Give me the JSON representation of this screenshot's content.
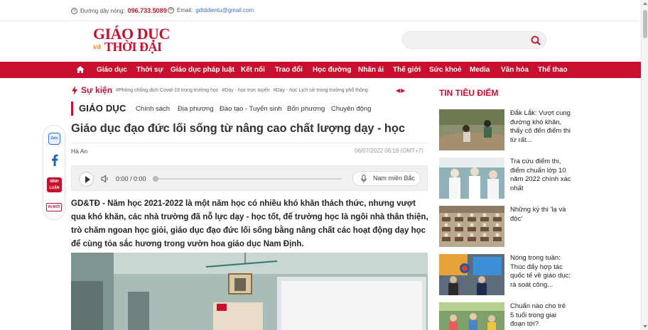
{
  "topbar": {
    "hotline_label": "Đường dây nóng:",
    "hotline_number": "096.733.5089",
    "email_label": "Email:",
    "email_value": "gdtddientu@gmail.com"
  },
  "logo": {
    "line1": "GIÁO DỤC",
    "line2": "THỜI ĐẠI",
    "joiner": "và"
  },
  "search": {
    "placeholder": ""
  },
  "nav": {
    "items": [
      "Giáo dục",
      "Thời sự",
      "Giáo dục pháp luật",
      "Kết nối",
      "Trao đổi",
      "Học đường",
      "Nhân ái",
      "Thế giới",
      "Sức khoẻ",
      "Media",
      "Văn hóa",
      "Thể thao"
    ]
  },
  "events": {
    "title": "Sự kiện",
    "tags": [
      "#Phòng chống dịch Covid-19 trong trường học",
      "#Dạy - học trực tuyến",
      "#Dạy - học Lịch sử trong trường phổ thông"
    ]
  },
  "category": {
    "title": "GIÁO DỤC",
    "subs": [
      "Chính sách",
      "Địa phương",
      "Đào tạo - Tuyển sinh",
      "Bốn phương",
      "Chuyên động"
    ]
  },
  "share": {
    "zalo": "Zalo",
    "comment_line1": "BÌNH",
    "comment_line2": "LUẬN",
    "print": "IN MỚI"
  },
  "article": {
    "title": "Giáo dục đạo đức lối sống từ nâng cao chất lượng dạy - học",
    "author": "Hà An",
    "date": "06/07/2022 06:19 (GMT+7)",
    "sapo": "GD&TĐ - Năm học 2021-2022 là một năm học có nhiều khó khăn thách thức, nhưng vượt qua khó khăn, các nhà trường đã nỗ lực dạy - học tốt, để trường học là ngôi nhà thân thiện, trò chăm ngoan học giỏi, giáo dục đạo đức lối sống bằng nâng chất các hoạt động dạy học để cùng tỏa sắc hương trong vườn hoa giáo dục Nam Định."
  },
  "audio": {
    "time": "0:00 / 0:00",
    "voice": "Nam miền Bắc"
  },
  "sidebar": {
    "title": "TIN TIÊU ĐIỂM",
    "items": [
      {
        "text": "Đắk Lắk: Vượt cung đường khó khăn, thấy cô đến điểm thi từ rất..."
      },
      {
        "text": "Tra cứu điểm thi, điểm chuẩn lớp 10 năm 2022 chính xác nhất"
      },
      {
        "text": "Những kỳ thi 'lạ và độc'"
      },
      {
        "text": "Nóng trong tuần: Thúc đẩy hợp tác quốc tế về giáo dục; rà soát công..."
      },
      {
        "text": "Chuẩn nào cho trẻ 5 tuổi trong giai đoạn tới?"
      }
    ]
  },
  "colors": {
    "brand": "#c8102e",
    "accent_orange": "#f08a1c"
  }
}
